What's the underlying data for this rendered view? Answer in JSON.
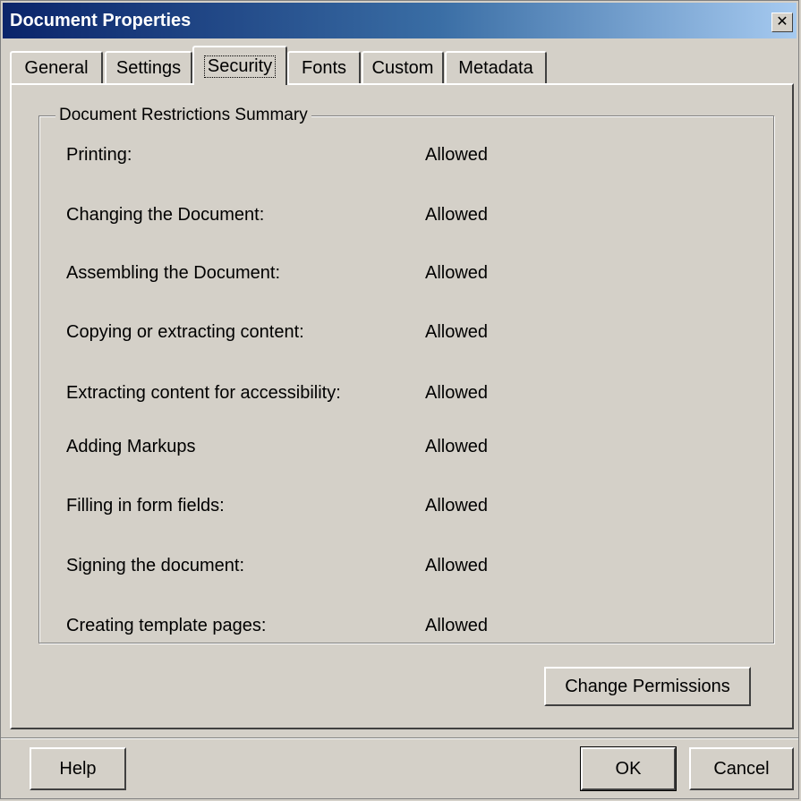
{
  "window": {
    "title": "Document Properties",
    "close_symbol": "✕"
  },
  "tabs": [
    {
      "label": "General"
    },
    {
      "label": "Settings"
    },
    {
      "label": "Security",
      "active": true
    },
    {
      "label": "Fonts"
    },
    {
      "label": "Custom"
    },
    {
      "label": "Metadata"
    }
  ],
  "group": {
    "title": "Document Restrictions Summary"
  },
  "restrictions": [
    {
      "label": "Printing:",
      "value": "Allowed"
    },
    {
      "label": "Changing the Document:",
      "value": "Allowed"
    },
    {
      "label": "Assembling the Document:",
      "value": "Allowed"
    },
    {
      "label": "Copying or extracting content:",
      "value": "Allowed"
    },
    {
      "label": "Extracting content for accessibility:",
      "value": "Allowed"
    },
    {
      "label": "Adding Markups",
      "value": "Allowed"
    },
    {
      "label": "Filling in form fields:",
      "value": "Allowed"
    },
    {
      "label": "Signing the document:",
      "value": "Allowed"
    },
    {
      "label": "Creating template pages:",
      "value": "Allowed"
    }
  ],
  "buttons": {
    "change_permissions": "Change Permissions",
    "help": "Help",
    "ok": "OK",
    "cancel": "Cancel"
  },
  "colors": {
    "titlebar_start": "#0a246a",
    "titlebar_end": "#a6caf0",
    "face": "#d4d0c8"
  }
}
